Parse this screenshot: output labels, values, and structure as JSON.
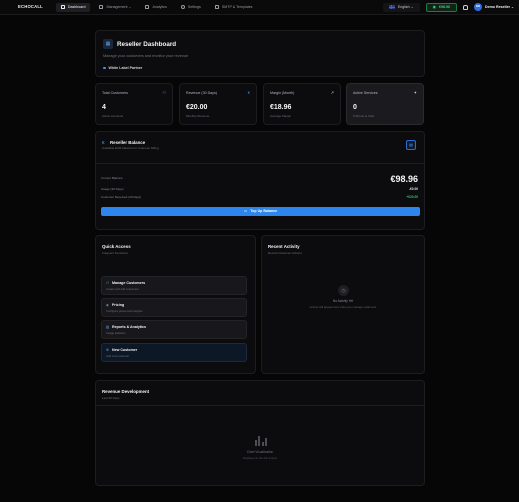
{
  "nav": {
    "brand": "ECHOCALL",
    "items": [
      {
        "label": "Dashboard",
        "active": true,
        "icon": "grid-icon"
      },
      {
        "label": "Management ⌄",
        "active": false,
        "icon": "users-icon"
      },
      {
        "label": "Analytics",
        "active": false,
        "icon": "chart-icon"
      },
      {
        "label": "Settings",
        "active": false,
        "icon": "gear-icon"
      },
      {
        "label": "SMTP & Templates",
        "active": false,
        "icon": "mail-icon"
      }
    ],
    "language": "English ⌄",
    "balance": "€98.96",
    "avatar_initials": "DR",
    "user_name": "Demo Reseller ⌄"
  },
  "header": {
    "title": "Reseller Dashboard",
    "subtitle": "Manage your customers and monitor your revenue",
    "badge": "White Label Partner"
  },
  "stats": [
    {
      "label": "Total Customers",
      "value": "4",
      "sub": "Active Accounts",
      "icon": "users-icon"
    },
    {
      "label": "Revenue (30 Days)",
      "value": "€20.00",
      "sub": "Monthly Revenue",
      "icon": "euro-icon"
    },
    {
      "label": "Margin (Month)",
      "value": "€18.96",
      "sub": "Average Margin",
      "icon": "trend-up-icon"
    },
    {
      "label": "Active Services",
      "value": "0",
      "sub": "5 Phone & Chat",
      "icon": "star-icon"
    }
  ],
  "balance": {
    "title": "Reseller Balance",
    "subtitle": "Available EUR balance for customer billing",
    "current_label": "Current Balance",
    "current_value": "€98.96",
    "usage_label": "Usage (30 Days)",
    "usage_value": "-€0.00",
    "received_label": "Customer Received (30 Days)",
    "received_value": "+€20.00",
    "topup_label": "Top Up Balance",
    "colors": {
      "accent": "#2d86ee",
      "positive": "#37c46b"
    }
  },
  "quick_access": {
    "title": "Quick Access",
    "subtitle": "Frequent Functions",
    "items": [
      {
        "title": "Manage Customers",
        "sub": "Create and edit customers"
      },
      {
        "title": "Pricing",
        "sub": "Configure prices and margins"
      },
      {
        "title": "Reports & Analytics",
        "sub": "Usage statistics"
      },
      {
        "title": "New Customer",
        "sub": "Add new customer"
      }
    ]
  },
  "recent_activity": {
    "title": "Recent Activity",
    "subtitle": "Recent Customer Actions",
    "empty_title": "No Activity Yet",
    "empty_text": "Activity will appear here when you manage customers"
  },
  "revenue": {
    "title": "Revenue Development",
    "subtitle": "Last 30 Days",
    "placeholder_title": "Chart Visualization",
    "placeholder_text": "Displayed in the full version"
  }
}
